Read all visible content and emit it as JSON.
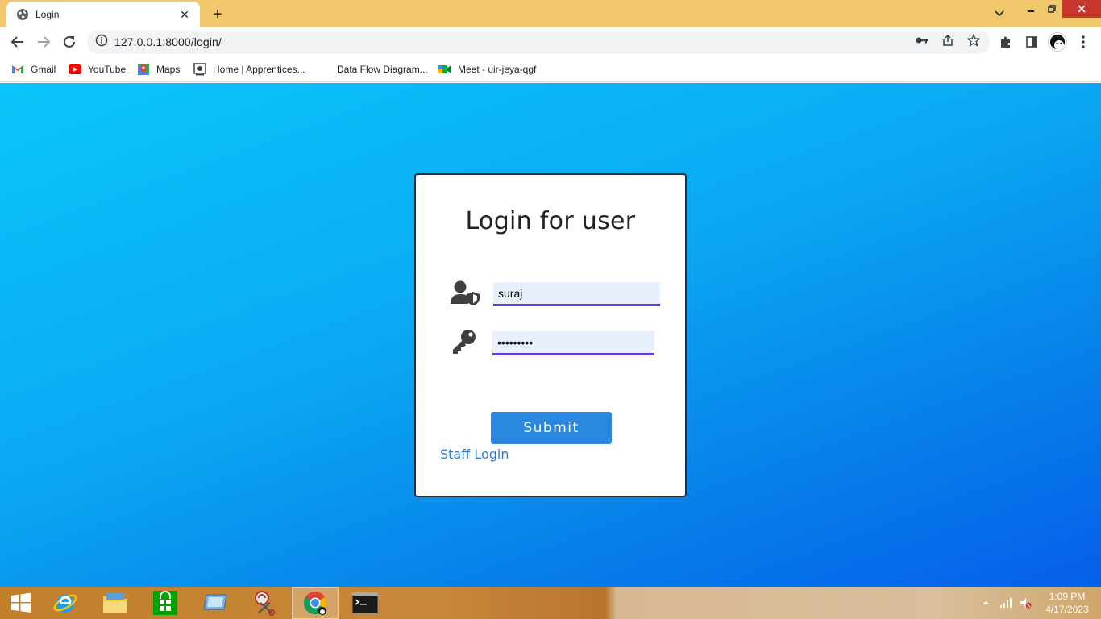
{
  "browser": {
    "tab": {
      "title": "Login",
      "favicon": "globe-icon"
    },
    "address_bar": {
      "url": "127.0.0.1:8000/login/",
      "info_icon": "info-icon"
    },
    "bookmarks": [
      {
        "label": "Gmail",
        "icon": "gmail-icon"
      },
      {
        "label": "YouTube",
        "icon": "youtube-icon"
      },
      {
        "label": "Maps",
        "icon": "maps-icon"
      },
      {
        "label": "Home | Apprentices...",
        "icon": "page-icon"
      },
      {
        "label": "Data Flow Diagram...",
        "icon": "blank"
      },
      {
        "label": "Meet - uir-jeya-qgf",
        "icon": "meet-icon"
      }
    ]
  },
  "login": {
    "title": "Login for user",
    "username_value": "suraj",
    "password_value": "•••••••••",
    "submit_label": "Submit",
    "staff_link": "Staff Login",
    "accent_color": "#5d3fd3",
    "button_color": "#2b88e0"
  },
  "taskbar": {
    "apps": [
      "windows-start-icon",
      "internet-explorer-icon",
      "file-explorer-icon",
      "store-icon",
      "remote-desktop-icon",
      "snipping-tool-icon",
      "chrome-icon",
      "command-prompt-icon"
    ],
    "clock": {
      "time": "1:09 PM",
      "date": "4/17/2023"
    }
  }
}
